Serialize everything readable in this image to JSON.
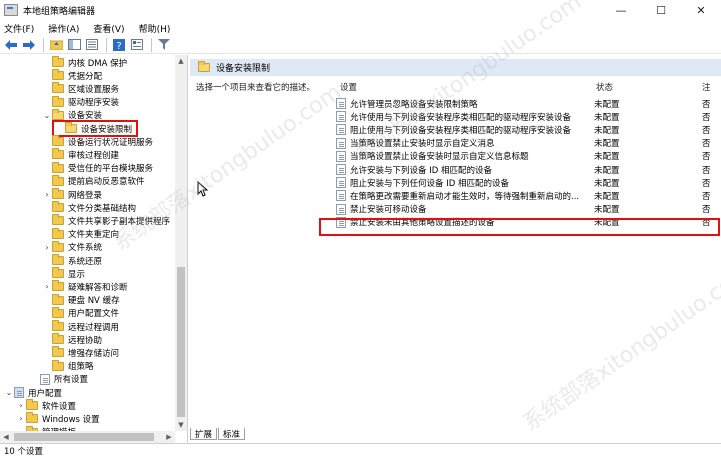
{
  "window": {
    "title": "本地组策略编辑器",
    "min": "—",
    "max": "☐",
    "close": "✕"
  },
  "menu": [
    "文件(F)",
    "操作(A)",
    "查看(V)",
    "帮助(H)"
  ],
  "left_tree": [
    {
      "label": "内核 DMA 保护",
      "depth": 3,
      "toggle": "",
      "icon": "folder"
    },
    {
      "label": "凭据分配",
      "depth": 3,
      "toggle": "",
      "icon": "folder"
    },
    {
      "label": "区域设置服务",
      "depth": 3,
      "toggle": "",
      "icon": "folder"
    },
    {
      "label": "驱动程序安装",
      "depth": 3,
      "toggle": "",
      "icon": "folder"
    },
    {
      "label": "设备安装",
      "depth": 3,
      "toggle": "⌄",
      "icon": "folder-open"
    },
    {
      "label": "设备安装限制",
      "depth": 4,
      "toggle": "",
      "icon": "folder-open",
      "selected": true
    },
    {
      "label": "设备运行状况证明服务",
      "depth": 3,
      "toggle": "",
      "icon": "folder"
    },
    {
      "label": "审核过程创建",
      "depth": 3,
      "toggle": "",
      "icon": "folder"
    },
    {
      "label": "受信任的平台模块服务",
      "depth": 3,
      "toggle": "",
      "icon": "folder"
    },
    {
      "label": "提前启动反恶意软件",
      "depth": 3,
      "toggle": "",
      "icon": "folder"
    },
    {
      "label": "网络登录",
      "depth": 3,
      "toggle": "›",
      "icon": "folder"
    },
    {
      "label": "文件分类基础结构",
      "depth": 3,
      "toggle": "",
      "icon": "folder"
    },
    {
      "label": "文件共享影子副本提供程序",
      "depth": 3,
      "toggle": "",
      "icon": "folder"
    },
    {
      "label": "文件夹重定向",
      "depth": 3,
      "toggle": "",
      "icon": "folder"
    },
    {
      "label": "文件系统",
      "depth": 3,
      "toggle": "›",
      "icon": "folder"
    },
    {
      "label": "系统还原",
      "depth": 3,
      "toggle": "",
      "icon": "folder"
    },
    {
      "label": "显示",
      "depth": 3,
      "toggle": "",
      "icon": "folder"
    },
    {
      "label": "疑难解答和诊断",
      "depth": 3,
      "toggle": "›",
      "icon": "folder"
    },
    {
      "label": "硬盘 NV 缓存",
      "depth": 3,
      "toggle": "",
      "icon": "folder"
    },
    {
      "label": "用户配置文件",
      "depth": 3,
      "toggle": "",
      "icon": "folder"
    },
    {
      "label": "远程过程调用",
      "depth": 3,
      "toggle": "",
      "icon": "folder"
    },
    {
      "label": "远程协助",
      "depth": 3,
      "toggle": "",
      "icon": "folder"
    },
    {
      "label": "增强存储访问",
      "depth": 3,
      "toggle": "",
      "icon": "folder"
    },
    {
      "label": "组策略",
      "depth": 3,
      "toggle": "",
      "icon": "folder"
    },
    {
      "label": "所有设置",
      "depth": 2,
      "toggle": "",
      "icon": "policy"
    },
    {
      "label": "用户配置",
      "depth": 0,
      "toggle": "⌄",
      "icon": "user"
    },
    {
      "label": "软件设置",
      "depth": 1,
      "toggle": "›",
      "icon": "folder"
    },
    {
      "label": "Windows 设置",
      "depth": 1,
      "toggle": "›",
      "icon": "folder"
    },
    {
      "label": "管理模板",
      "depth": 1,
      "toggle": "›",
      "icon": "folder"
    }
  ],
  "right_pane": {
    "header": "设备安装限制",
    "description": "选择一个项目来查看它的描述。",
    "col_setting": "设置",
    "col_state": "状态",
    "col_note": "注",
    "policies": [
      {
        "name": "允许管理员忽略设备安装限制策略",
        "state": "未配置",
        "note": "否"
      },
      {
        "name": "允许使用与下列设备安装程序类相匹配的驱动程序安装设备",
        "state": "未配置",
        "note": "否"
      },
      {
        "name": "阻止使用与下列设备安装程序类相匹配的驱动程序安装设备",
        "state": "未配置",
        "note": "否"
      },
      {
        "name": "当策略设置禁止安装时显示自定义消息",
        "state": "未配置",
        "note": "否"
      },
      {
        "name": "当策略设置禁止设备安装时显示自定义信息标题",
        "state": "未配置",
        "note": "否"
      },
      {
        "name": "允许安装与下列设备 ID 相匹配的设备",
        "state": "未配置",
        "note": "否"
      },
      {
        "name": "阻止安装与下列任何设备 ID 相匹配的设备",
        "state": "未配置",
        "note": "否"
      },
      {
        "name": "在策略更改需要重新启动才能生效时，等待强制重新启动的...",
        "state": "未配置",
        "note": "否"
      },
      {
        "name": "禁止安装可移动设备",
        "state": "未配置",
        "note": "否"
      },
      {
        "name": "禁止安装未由其他策略设置描述的设备",
        "state": "未配置",
        "note": "否"
      }
    ]
  },
  "tabs": [
    "扩展",
    "标准"
  ],
  "status": "10 个设置",
  "watermark": "系统部落xitongbuluo.com",
  "colors": {
    "selection_box": "#e01010",
    "header_bg": "#dfe9f5",
    "folder": "#f2c94c"
  }
}
